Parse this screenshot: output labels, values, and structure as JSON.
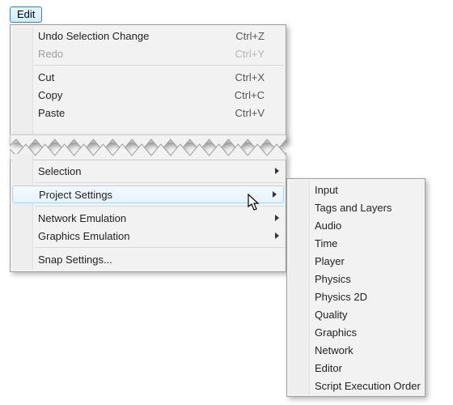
{
  "editButton": {
    "label": "Edit"
  },
  "topMenu": {
    "items": [
      {
        "label": "Undo Selection Change",
        "shortcut": "Ctrl+Z",
        "disabled": false
      },
      {
        "label": "Redo",
        "shortcut": "Ctrl+Y",
        "disabled": true
      },
      {
        "sep": true
      },
      {
        "label": "Cut",
        "shortcut": "Ctrl+X"
      },
      {
        "label": "Copy",
        "shortcut": "Ctrl+C"
      },
      {
        "label": "Paste",
        "shortcut": "Ctrl+V"
      }
    ]
  },
  "lowerMenu": {
    "items": [
      {
        "label": "Selection",
        "submenu": true
      },
      {
        "sep": true
      },
      {
        "label": "Project Settings",
        "submenu": true,
        "highlight": true
      },
      {
        "sep": true
      },
      {
        "label": "Network Emulation",
        "submenu": true
      },
      {
        "label": "Graphics Emulation",
        "submenu": true
      },
      {
        "sep": true
      },
      {
        "label": "Snap Settings..."
      }
    ]
  },
  "submenu": {
    "items": [
      {
        "label": "Input"
      },
      {
        "label": "Tags and Layers"
      },
      {
        "label": "Audio"
      },
      {
        "label": "Time"
      },
      {
        "label": "Player"
      },
      {
        "label": "Physics"
      },
      {
        "label": "Physics 2D"
      },
      {
        "label": "Quality"
      },
      {
        "label": "Graphics"
      },
      {
        "label": "Network"
      },
      {
        "label": "Editor"
      },
      {
        "label": "Script Execution Order"
      }
    ]
  }
}
